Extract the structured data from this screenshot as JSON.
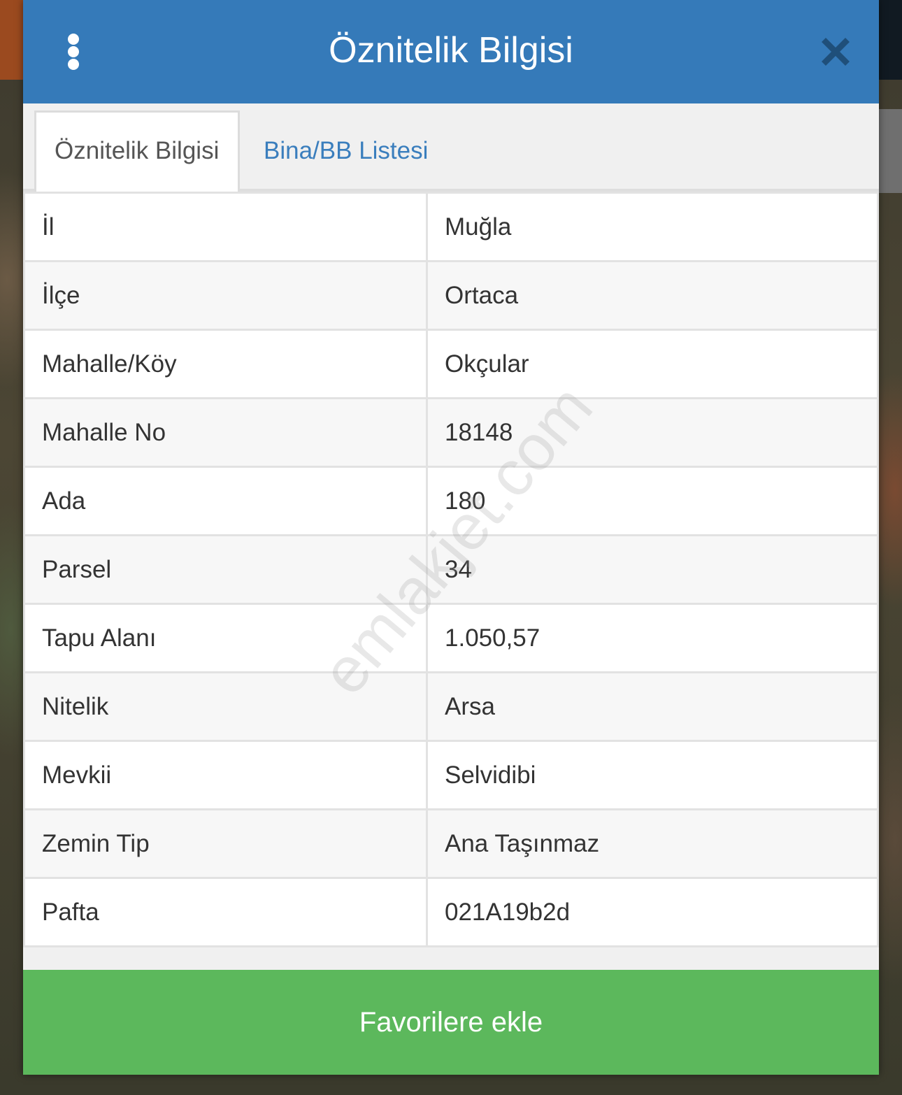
{
  "dialog": {
    "title": "Öznitelik Bilgisi",
    "menu_icon": "vertical-dots-icon",
    "close_icon": "close-icon"
  },
  "tabs": [
    {
      "label": "Öznitelik Bilgisi",
      "active": true
    },
    {
      "label": "Bina/BB Listesi",
      "active": false
    }
  ],
  "attributes": [
    {
      "label": "İl",
      "value": "Muğla"
    },
    {
      "label": "İlçe",
      "value": "Ortaca"
    },
    {
      "label": "Mahalle/Köy",
      "value": "Okçular"
    },
    {
      "label": "Mahalle No",
      "value": "18148"
    },
    {
      "label": "Ada",
      "value": "180"
    },
    {
      "label": "Parsel",
      "value": "34"
    },
    {
      "label": "Tapu Alanı",
      "value": "1.050,57"
    },
    {
      "label": "Nitelik",
      "value": "Arsa"
    },
    {
      "label": "Mevkii",
      "value": "Selvidibi"
    },
    {
      "label": "Zemin Tip",
      "value": "Ana Taşınmaz"
    },
    {
      "label": "Pafta",
      "value": "021A19b2d"
    }
  ],
  "watermark": "emlakjet.com",
  "footer": {
    "favorite_label": "Favorilere ekle"
  },
  "colors": {
    "header": "#357ab9",
    "tab_link": "#3a7ebd",
    "favorite_button": "#5cb85c"
  }
}
